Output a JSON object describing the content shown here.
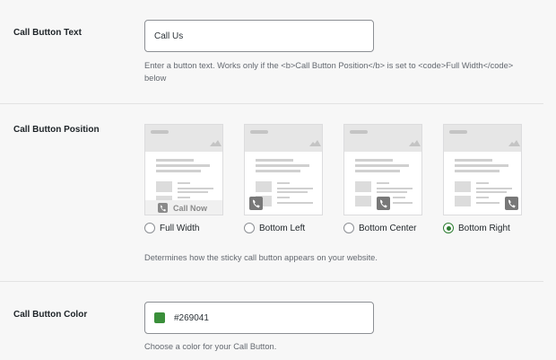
{
  "button_text": {
    "label": "Call Button Text",
    "value": "Call Us",
    "help": "Enter a button text. Works only if the <b>Call Button Position</b> is set to <code>Full Width</code> below"
  },
  "button_position": {
    "label": "Call Button Position",
    "preview_call_now": "Call Now",
    "options": [
      {
        "label": "Full Width",
        "checked": false
      },
      {
        "label": "Bottom Left",
        "checked": false
      },
      {
        "label": "Bottom Center",
        "checked": false
      },
      {
        "label": "Bottom Right",
        "checked": true
      }
    ],
    "help": "Determines how the sticky call button appears on your website."
  },
  "button_color": {
    "label": "Call Button Color",
    "value": "#269041",
    "swatch": "#3a8f3a",
    "help": "Choose a color for your Call Button."
  },
  "colors": {
    "accent": "#2e7d32",
    "preview_gray": "#c9c9c9",
    "phone_button": "#787878"
  }
}
